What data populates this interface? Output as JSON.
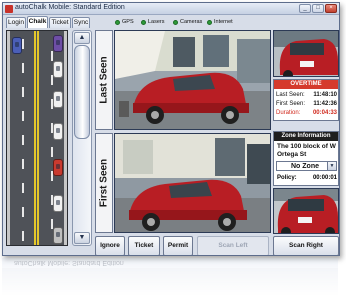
{
  "window": {
    "title": "autoChalk Mobile: Standard Edition",
    "controls": {
      "minimize": "_",
      "maximize": "□",
      "close": "×"
    }
  },
  "tabs": [
    {
      "label": "Login"
    },
    {
      "label": "Chalk"
    },
    {
      "label": "Ticket"
    },
    {
      "label": "Sync"
    }
  ],
  "active_tab": "Chalk",
  "status_indicators": [
    {
      "label": "GPS",
      "color": "#2e9a3a"
    },
    {
      "label": "Lasers",
      "color": "#2e9a3a"
    },
    {
      "label": "Cameras",
      "color": "#2e9a3a"
    },
    {
      "label": "Internet",
      "color": "#2e9a3a"
    }
  ],
  "street_view": {
    "car_colors": [
      "#4b5fb8",
      "#f1f1f1",
      "#6e4ea6",
      "#f1f1f1",
      "#f1f1f1",
      "#c93a2f",
      "#f1f1f1",
      "#bfbfbf"
    ]
  },
  "photos": {
    "last_seen_label": "Last Seen",
    "first_seen_label": "First Seen"
  },
  "overtime": {
    "header": "OVERTIME",
    "last_seen_label": "Last Seen:",
    "last_seen_value": "11:48:10",
    "first_seen_label": "First Seen:",
    "first_seen_value": "11:42:36",
    "duration_label": "Duration:",
    "duration_value": "00:04:33"
  },
  "zone": {
    "header": "Zone Information",
    "address": "The 100 block of W Ortega St",
    "selected_zone": "No Zone",
    "policy_label": "Policy:",
    "policy_value": "00:00:01"
  },
  "buttons": {
    "ignore": "Ignore",
    "ticket": "Ticket",
    "permit": "Permit",
    "scan_left": "Scan Left",
    "scan_right": "Scan Right"
  },
  "colors": {
    "accent_red": "#d53a2c",
    "status_green": "#2e9a3a",
    "window_bg": "#d7dde8"
  }
}
